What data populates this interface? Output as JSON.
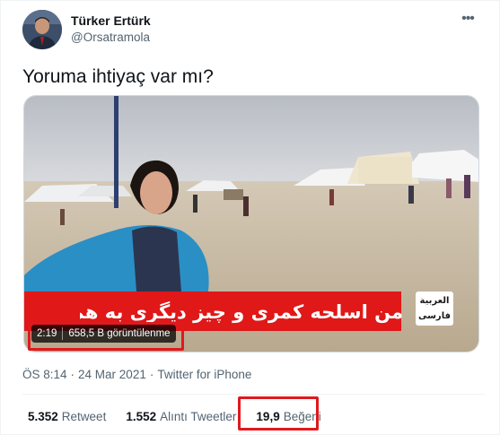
{
  "author": {
    "name": "Türker Ertürk",
    "handle": "@Orsatramola"
  },
  "tweet": {
    "text": "Yoruma ihtiyaç var mı?"
  },
  "media": {
    "caption": "من اسلحه کمری و چیز دیگری به همراه ندارم",
    "logo_line1": "العربية",
    "logo_line2": "فارسی",
    "duration": "2:19",
    "views": "658,5 B görüntülenme",
    "highlight_color": "#e0191e"
  },
  "meta": {
    "time": "ÖS 8:14",
    "separator": "·",
    "date": "24 Mar 2021",
    "source": "Twitter for iPhone"
  },
  "stats": {
    "retweets_num": "5.352",
    "retweets_label": "Retweet",
    "quotes_num": "1.552",
    "quotes_label": "Alıntı Tweetler",
    "likes_num": "19,9",
    "likes_label": "Beğeni"
  },
  "icons": {
    "more": "more-horizontal-icon"
  }
}
